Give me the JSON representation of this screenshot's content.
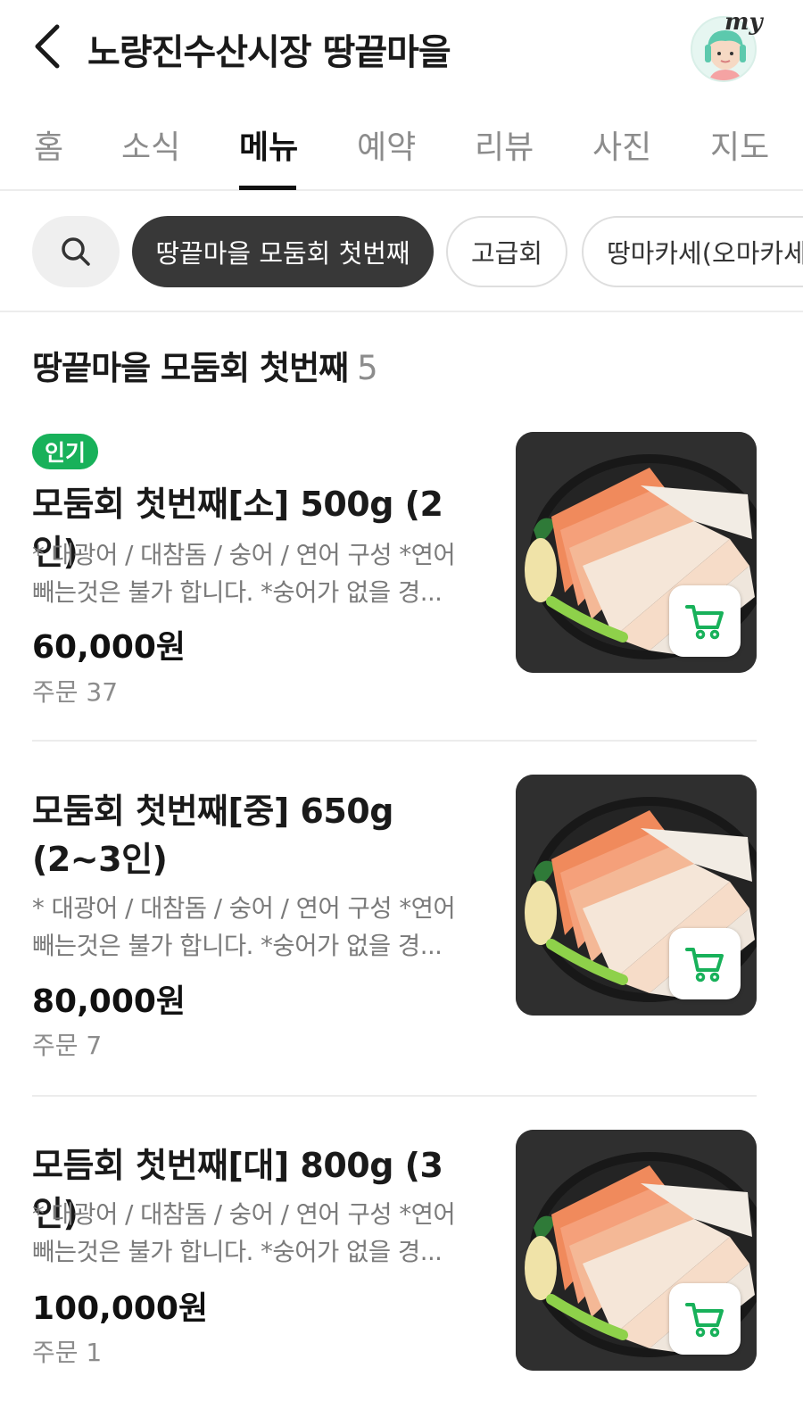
{
  "header": {
    "title": "노량진수산시장 땅끝마을",
    "my_label": "my"
  },
  "tabs": [
    {
      "label": "홈",
      "active": false
    },
    {
      "label": "소식",
      "active": false
    },
    {
      "label": "메뉴",
      "active": true
    },
    {
      "label": "예약",
      "active": false
    },
    {
      "label": "리뷰",
      "active": false
    },
    {
      "label": "사진",
      "active": false
    },
    {
      "label": "지도",
      "active": false
    }
  ],
  "chips": [
    {
      "label": "땅끝마을 모둠회 첫번째",
      "active": true
    },
    {
      "label": "고급회",
      "active": false
    },
    {
      "label": "땅마카세(오마카세",
      "active": false
    }
  ],
  "section": {
    "title": "땅끝마을 모둠회 첫번째",
    "count": "5"
  },
  "items": [
    {
      "badge": "인기",
      "name": "모둠회 첫번째[소] 500g (2인)",
      "description": "* 대광어 / 대참돔 / 숭어 / 연어 구성 *연어 빼는것은 불가 합니다. *숭어가 없을 경...",
      "price": "60,000원",
      "orders": "주문 37"
    },
    {
      "badge": "",
      "name": "모둠회 첫번째[중] 650g (2~3인)",
      "description": "* 대광어 / 대참돔 / 숭어 / 연어 구성 *연어 빼는것은 불가 합니다. *숭어가 없을 경...",
      "price": "80,000원",
      "orders": "주문 7"
    },
    {
      "badge": "",
      "name": "모듬회 첫번째[대] 800g (3인)",
      "description": "* 대광어 / 대참돔 / 숭어 / 연어 구성 *연어 빼는것은 불가 합니다. *숭어가 없을 경...",
      "price": "100,000원",
      "orders": "주문 1"
    }
  ],
  "colors": {
    "accent_green": "#18b15a",
    "active_chip": "#383838",
    "muted_text": "#8c8c8c"
  },
  "icons": {
    "back": "chevron-left-icon",
    "search": "search-icon",
    "cart": "cart-icon"
  }
}
